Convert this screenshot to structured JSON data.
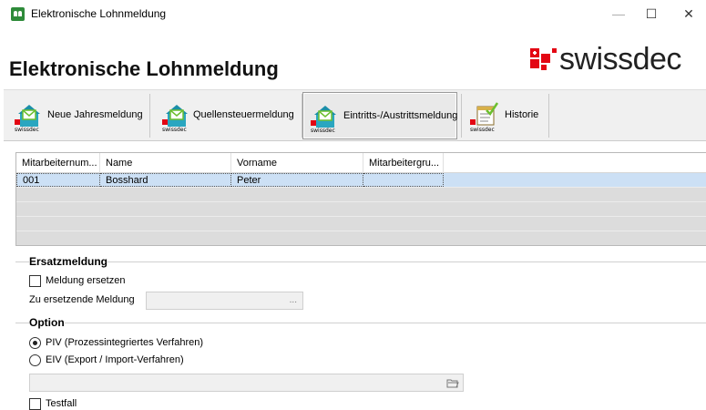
{
  "window": {
    "title": "Elektronische Lohnmeldung",
    "min": "—",
    "max": "☐",
    "close": "✕"
  },
  "header": {
    "title": "Elektronische Lohnmeldung",
    "logo_text": "swissdec"
  },
  "toolbar": {
    "buttons": [
      {
        "label": "Neue Jahresmeldung",
        "icon": "envelope-house-icon",
        "active": false
      },
      {
        "label": "Quellensteuermeldung",
        "icon": "envelope-house-icon",
        "active": false
      },
      {
        "label": "Eintritts-/Austrittsmeldung",
        "icon": "envelope-house-icon",
        "active": true
      },
      {
        "label": "Historie",
        "icon": "checklist-icon",
        "active": false
      }
    ],
    "badge_text": "swissdec"
  },
  "grid": {
    "columns": [
      "Mitarbeiternum...",
      "Name",
      "Vorname",
      "Mitarbeitergru..."
    ],
    "rows": [
      [
        "001",
        "Bosshard",
        "Peter",
        ""
      ]
    ]
  },
  "ersatzmeldung": {
    "title": "Ersatzmeldung",
    "checkbox_label": "Meldung ersetzen",
    "field_label": "Zu ersetzende Meldung",
    "field_button": "..."
  },
  "option": {
    "title": "Option",
    "radio_piv": "PIV (Prozessintegriertes Verfahren)",
    "radio_eiv": "EIV (Export / Import-Verfahren)",
    "selected": "PIV",
    "testfall": "Testfall"
  },
  "colors": {
    "selection": "#cce0f5",
    "swissdec_red": "#e30613",
    "icon_teal": "#1b8fa8",
    "icon_green": "#6cbf2f"
  }
}
